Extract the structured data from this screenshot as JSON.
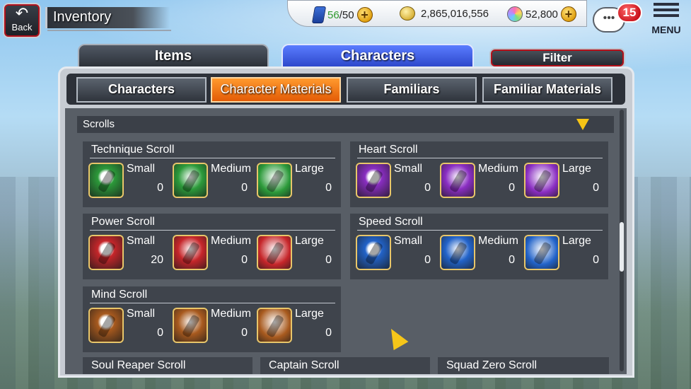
{
  "header": {
    "back_label": "Back",
    "title": "Inventory",
    "stamina": {
      "current": "56",
      "max": "/50"
    },
    "currency": "2,865,016,556",
    "orbs": "52,800",
    "notification_count": "15",
    "menu_label": "MENU"
  },
  "main_tabs": [
    {
      "label": "Items"
    },
    {
      "label": "Characters"
    }
  ],
  "filter_label": "Filter",
  "sub_tabs": [
    {
      "label": "Characters"
    },
    {
      "label": "Character Materials"
    },
    {
      "label": "Familiars"
    },
    {
      "label": "Familiar Materials"
    }
  ],
  "section": {
    "label": "Scrolls"
  },
  "cards": [
    {
      "title": "Technique Scroll",
      "icon": "green-scroll",
      "color": "#2c9a3a",
      "slots": [
        {
          "size": "Small",
          "count": "0"
        },
        {
          "size": "Medium",
          "count": "0"
        },
        {
          "size": "Large",
          "count": "0"
        }
      ]
    },
    {
      "title": "Heart Scroll",
      "icon": "purple-scroll",
      "color": "#8a2ec2",
      "slots": [
        {
          "size": "Small",
          "count": "0"
        },
        {
          "size": "Medium",
          "count": "0"
        },
        {
          "size": "Large",
          "count": "0"
        }
      ]
    },
    {
      "title": "Power Scroll",
      "icon": "red-scroll",
      "color": "#c6262a",
      "slots": [
        {
          "size": "Small",
          "count": "20"
        },
        {
          "size": "Medium",
          "count": "0"
        },
        {
          "size": "Large",
          "count": "0"
        }
      ]
    },
    {
      "title": "Speed Scroll",
      "icon": "blue-scroll",
      "color": "#2263c9",
      "slots": [
        {
          "size": "Small",
          "count": "0"
        },
        {
          "size": "Medium",
          "count": "0"
        },
        {
          "size": "Large",
          "count": "0"
        }
      ]
    },
    {
      "title": "Mind Scroll",
      "icon": "brown-scroll",
      "color": "#a85a1e",
      "slots": [
        {
          "size": "Small",
          "count": "0"
        },
        {
          "size": "Medium",
          "count": "0"
        },
        {
          "size": "Large",
          "count": "0"
        }
      ]
    }
  ],
  "peek_cards": [
    {
      "title": "Soul Reaper Scroll"
    },
    {
      "title": "Captain Scroll"
    },
    {
      "title": "Squad Zero Scroll"
    }
  ]
}
